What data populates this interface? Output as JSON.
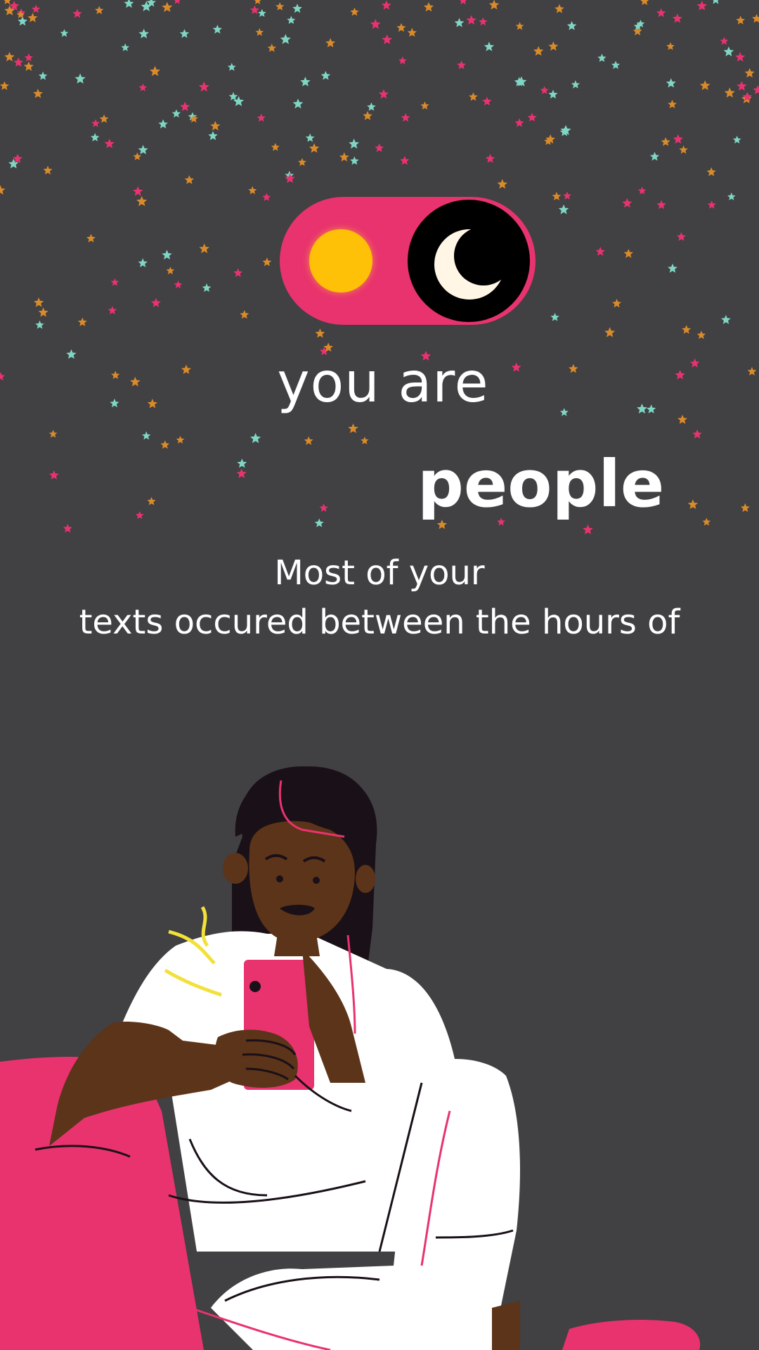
{
  "theme": {
    "background": "#414042",
    "accent_pink": "#e8336e",
    "sun_yellow": "#ffc107",
    "star_colors": [
      "#d98b2b",
      "#7fd6c4",
      "#e8336e"
    ]
  },
  "toggle": {
    "left_icon": "sun-icon",
    "right_icon": "moon-icon",
    "state": "night"
  },
  "headline": {
    "line1": "you are",
    "line2": "people"
  },
  "subtitle": {
    "line1": "Most of your",
    "line2": "texts occured between the hours of"
  },
  "illustration": "woman-texting-on-phone"
}
